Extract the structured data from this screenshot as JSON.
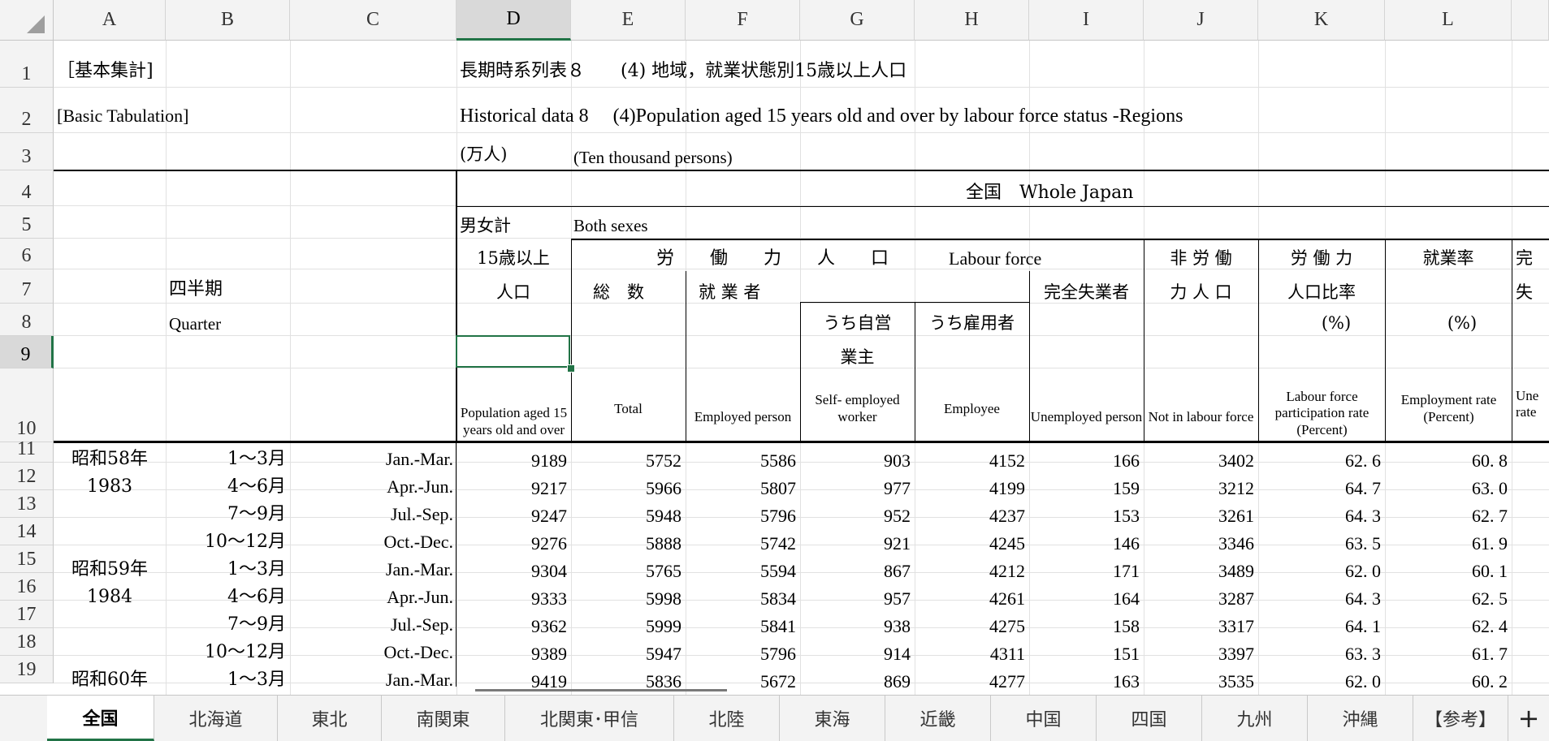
{
  "columns": [
    "A",
    "B",
    "C",
    "D",
    "E",
    "F",
    "G",
    "H",
    "I",
    "J",
    "K",
    "L",
    ""
  ],
  "rows": [
    "1",
    "2",
    "3",
    "4",
    "5",
    "6",
    "7",
    "8",
    "9",
    "10",
    "11",
    "12",
    "13",
    "14",
    "15",
    "16",
    "17",
    "18",
    "19"
  ],
  "title": {
    "a1": "［基本集計]",
    "a2": "[Basic Tabulation]",
    "d1": "長期時系列表８　　(4) 地域，就業状態別15歳以上人口",
    "d2": "Historical data 8　 (4)Population aged 15 years old and over by labour force status -Regions",
    "d3_jp": "(万人)",
    "d3_en": "(Ten thousand persons)"
  },
  "header": {
    "region": "全国　Whole Japan",
    "sex_jp": "男女計",
    "sex_en": "Both sexes",
    "quarter_jp": "四半期",
    "quarter_en": "Quarter",
    "pop15_jp_1": "15歳以上",
    "pop15_jp_2": "人口",
    "labour_force_jp": "労　　働　　力　　人　　口",
    "labour_force_en": "Labour force",
    "total_jp": "総　数",
    "employed_jp": "就 業 者",
    "self_emp_jp_1": "うち自営",
    "self_emp_jp_2": "業主",
    "employee_jp": "うち雇用者",
    "unemployed_jp": "完全失業者",
    "not_lf_jp_1": "非 労 働",
    "not_lf_jp_2": "力 人 口",
    "lfpr_jp_1": "労 働 力",
    "lfpr_jp_2": "人口比率",
    "lfpr_pct": "(%)",
    "emp_rate_jp": "就業率",
    "emp_rate_pct": "(%)",
    "unemp_rate_jp_1": "完",
    "unemp_rate_jp_2": "失",
    "en_pop15": "Population aged 15 years old and over",
    "en_total": "Total",
    "en_employed": "Employed person",
    "en_self": "Self- employed worker",
    "en_employee": "Employee",
    "en_unemployed": "Unemployed person",
    "en_not_lf": "Not in labour force",
    "en_lfpr": "Labour force participation rate (Percent)",
    "en_emp_rate": "Employment rate (Percent)",
    "en_unemp_rate": "Une rate"
  },
  "data_rows": [
    {
      "era": "昭和58年",
      "q_jp": "1～3月",
      "q_en": "Jan.-Mar.",
      "v": [
        "9189",
        "5752",
        "5586",
        "903",
        "4152",
        "166",
        "3402",
        "62. 6",
        "60. 8"
      ]
    },
    {
      "era": "1983",
      "q_jp": "4～6月",
      "q_en": "Apr.-Jun.",
      "v": [
        "9217",
        "5966",
        "5807",
        "977",
        "4199",
        "159",
        "3212",
        "64. 7",
        "63. 0"
      ]
    },
    {
      "era": "",
      "q_jp": "7～9月",
      "q_en": "Jul.-Sep.",
      "v": [
        "9247",
        "5948",
        "5796",
        "952",
        "4237",
        "153",
        "3261",
        "64. 3",
        "62. 7"
      ]
    },
    {
      "era": "",
      "q_jp": "10～12月",
      "q_en": "Oct.-Dec.",
      "v": [
        "9276",
        "5888",
        "5742",
        "921",
        "4245",
        "146",
        "3346",
        "63. 5",
        "61. 9"
      ]
    },
    {
      "era": "昭和59年",
      "q_jp": "1～3月",
      "q_en": "Jan.-Mar.",
      "v": [
        "9304",
        "5765",
        "5594",
        "867",
        "4212",
        "171",
        "3489",
        "62. 0",
        "60. 1"
      ]
    },
    {
      "era": "1984",
      "q_jp": "4～6月",
      "q_en": "Apr.-Jun.",
      "v": [
        "9333",
        "5998",
        "5834",
        "957",
        "4261",
        "164",
        "3287",
        "64. 3",
        "62. 5"
      ]
    },
    {
      "era": "",
      "q_jp": "7～9月",
      "q_en": "Jul.-Sep.",
      "v": [
        "9362",
        "5999",
        "5841",
        "938",
        "4275",
        "158",
        "3317",
        "64. 1",
        "62. 4"
      ]
    },
    {
      "era": "",
      "q_jp": "10～12月",
      "q_en": "Oct.-Dec.",
      "v": [
        "9389",
        "5947",
        "5796",
        "914",
        "4311",
        "151",
        "3397",
        "63. 3",
        "61. 7"
      ]
    },
    {
      "era": "昭和60年",
      "q_jp": "1～3月",
      "q_en": "Jan.-Mar.",
      "v": [
        "9419",
        "5836",
        "5672",
        "869",
        "4277",
        "163",
        "3535",
        "62. 0",
        "60. 2"
      ]
    }
  ],
  "sheet_tabs": [
    "全国",
    "北海道",
    "東北",
    "南関東",
    "北関東･甲信",
    "北陸",
    "東海",
    "近畿",
    "中国",
    "四国",
    "九州",
    "沖縄",
    "【参考】"
  ],
  "active_tab": "全国",
  "add_sheet": "+"
}
